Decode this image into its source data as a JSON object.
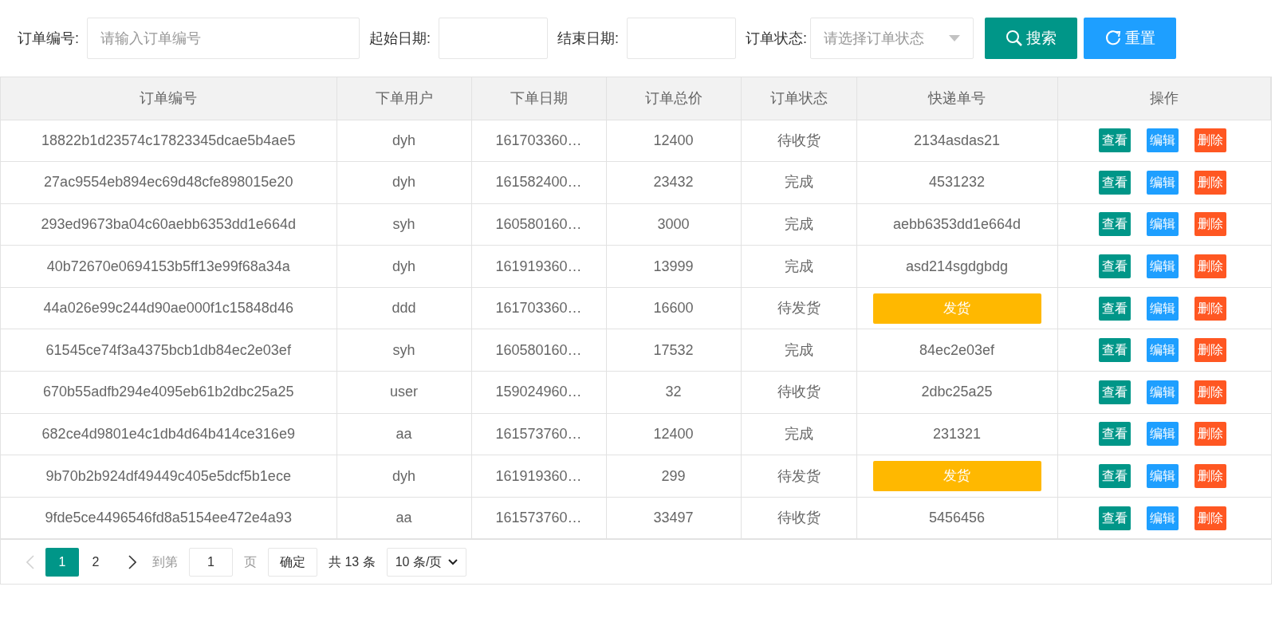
{
  "search_bar": {
    "fields": [
      {
        "kind": "text",
        "label": "订单编号:",
        "placeholder": "请输入订单编号"
      },
      {
        "kind": "date",
        "label": "起始日期:"
      },
      {
        "kind": "date",
        "label": "结束日期:"
      },
      {
        "kind": "select",
        "label": "订单状态:",
        "placeholder": "请选择订单状态"
      }
    ],
    "buttons": [
      {
        "kind": "search",
        "label": "搜索"
      },
      {
        "kind": "reset",
        "label": "重置"
      }
    ]
  },
  "table": {
    "columns": [
      "订单编号",
      "下单用户",
      "下单日期",
      "订单总价",
      "订单状态",
      "快递单号",
      "操作"
    ],
    "rows": [
      {
        "order_no": "18822b1d23574c17823345dcae5b4ae5",
        "user": "dyh",
        "date": "161703360…",
        "total": "12400",
        "status": "待收货",
        "tracking": {
          "kind": "text",
          "text": "2134asdas21"
        },
        "actions": [
          {
            "kind": "view",
            "label": "查看"
          },
          {
            "kind": "edit",
            "label": "编辑"
          },
          {
            "kind": "delete",
            "label": "删除"
          }
        ]
      },
      {
        "order_no": "27ac9554eb894ec69d48cfe898015e20",
        "user": "dyh",
        "date": "161582400…",
        "total": "23432",
        "status": "完成",
        "tracking": {
          "kind": "text",
          "text": "4531232"
        },
        "actions": [
          {
            "kind": "view",
            "label": "查看"
          },
          {
            "kind": "edit",
            "label": "编辑"
          },
          {
            "kind": "delete",
            "label": "删除"
          }
        ]
      },
      {
        "order_no": "293ed9673ba04c60aebb6353dd1e664d",
        "user": "syh",
        "date": "160580160…",
        "total": "3000",
        "status": "完成",
        "tracking": {
          "kind": "text",
          "text": "aebb6353dd1e664d"
        },
        "actions": [
          {
            "kind": "view",
            "label": "查看"
          },
          {
            "kind": "edit",
            "label": "编辑"
          },
          {
            "kind": "delete",
            "label": "删除"
          }
        ]
      },
      {
        "order_no": "40b72670e0694153b5ff13e99f68a34a",
        "user": "dyh",
        "date": "161919360…",
        "total": "13999",
        "status": "完成",
        "tracking": {
          "kind": "text",
          "text": "asd214sgdgbdg"
        },
        "actions": [
          {
            "kind": "view",
            "label": "查看"
          },
          {
            "kind": "edit",
            "label": "编辑"
          },
          {
            "kind": "delete",
            "label": "删除"
          }
        ]
      },
      {
        "order_no": "44a026e99c244d90ae000f1c15848d46",
        "user": "ddd",
        "date": "161703360…",
        "total": "16600",
        "status": "待发货",
        "tracking": {
          "kind": "ship_button",
          "text": "发货"
        },
        "actions": [
          {
            "kind": "view",
            "label": "查看"
          },
          {
            "kind": "edit",
            "label": "编辑"
          },
          {
            "kind": "delete",
            "label": "删除"
          }
        ]
      },
      {
        "order_no": "61545ce74f3a4375bcb1db84ec2e03ef",
        "user": "syh",
        "date": "160580160…",
        "total": "17532",
        "status": "完成",
        "tracking": {
          "kind": "text",
          "text": "84ec2e03ef"
        },
        "actions": [
          {
            "kind": "view",
            "label": "查看"
          },
          {
            "kind": "edit",
            "label": "编辑"
          },
          {
            "kind": "delete",
            "label": "删除"
          }
        ]
      },
      {
        "order_no": "670b55adfb294e4095eb61b2dbc25a25",
        "user": "user",
        "date": "159024960…",
        "total": "32",
        "status": "待收货",
        "tracking": {
          "kind": "text",
          "text": "2dbc25a25"
        },
        "actions": [
          {
            "kind": "view",
            "label": "查看"
          },
          {
            "kind": "edit",
            "label": "编辑"
          },
          {
            "kind": "delete",
            "label": "删除"
          }
        ]
      },
      {
        "order_no": "682ce4d9801e4c1db4d64b414ce316e9",
        "user": "aa",
        "date": "161573760…",
        "total": "12400",
        "status": "完成",
        "tracking": {
          "kind": "text",
          "text": "231321"
        },
        "actions": [
          {
            "kind": "view",
            "label": "查看"
          },
          {
            "kind": "edit",
            "label": "编辑"
          },
          {
            "kind": "delete",
            "label": "删除"
          }
        ]
      },
      {
        "order_no": "9b70b2b924df49449c405e5dcf5b1ece",
        "user": "dyh",
        "date": "161919360…",
        "total": "299",
        "status": "待发货",
        "tracking": {
          "kind": "ship_button",
          "text": "发货"
        },
        "actions": [
          {
            "kind": "view",
            "label": "查看"
          },
          {
            "kind": "edit",
            "label": "编辑"
          },
          {
            "kind": "delete",
            "label": "删除"
          }
        ]
      },
      {
        "order_no": "9fde5ce4496546fd8a5154ee472e4a93",
        "user": "aa",
        "date": "161573760…",
        "total": "33497",
        "status": "待收货",
        "tracking": {
          "kind": "text",
          "text": "5456456"
        },
        "actions": [
          {
            "kind": "view",
            "label": "查看"
          },
          {
            "kind": "edit",
            "label": "编辑"
          },
          {
            "kind": "delete",
            "label": "删除"
          }
        ]
      }
    ]
  },
  "pagination": {
    "prev_disabled": true,
    "pages": [
      {
        "label": "1",
        "selected": true
      },
      {
        "label": "2",
        "selected": false
      }
    ],
    "goto_label": "到第",
    "goto_value": "1",
    "page_unit": "页",
    "confirm": "确定",
    "total": "共 13 条",
    "page_size": "10 条/页"
  }
}
